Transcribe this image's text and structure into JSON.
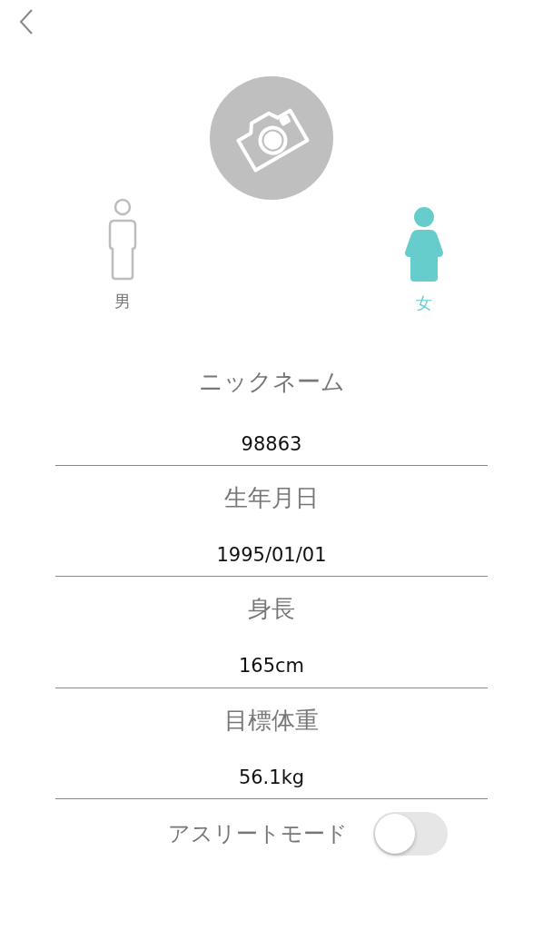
{
  "genders": [
    {
      "label": "男",
      "kind": "male",
      "selected": false
    },
    {
      "label": "女",
      "kind": "female",
      "selected": true
    }
  ],
  "fields": [
    {
      "label": "ニックネーム",
      "value": "98863"
    },
    {
      "label": "生年月日",
      "value": "1995/01/01"
    },
    {
      "label": "身長",
      "value": "165cm"
    },
    {
      "label": "目標体重",
      "value": "56.1kg"
    }
  ],
  "athlete_mode": {
    "label": "アスリートモード",
    "on": false
  }
}
